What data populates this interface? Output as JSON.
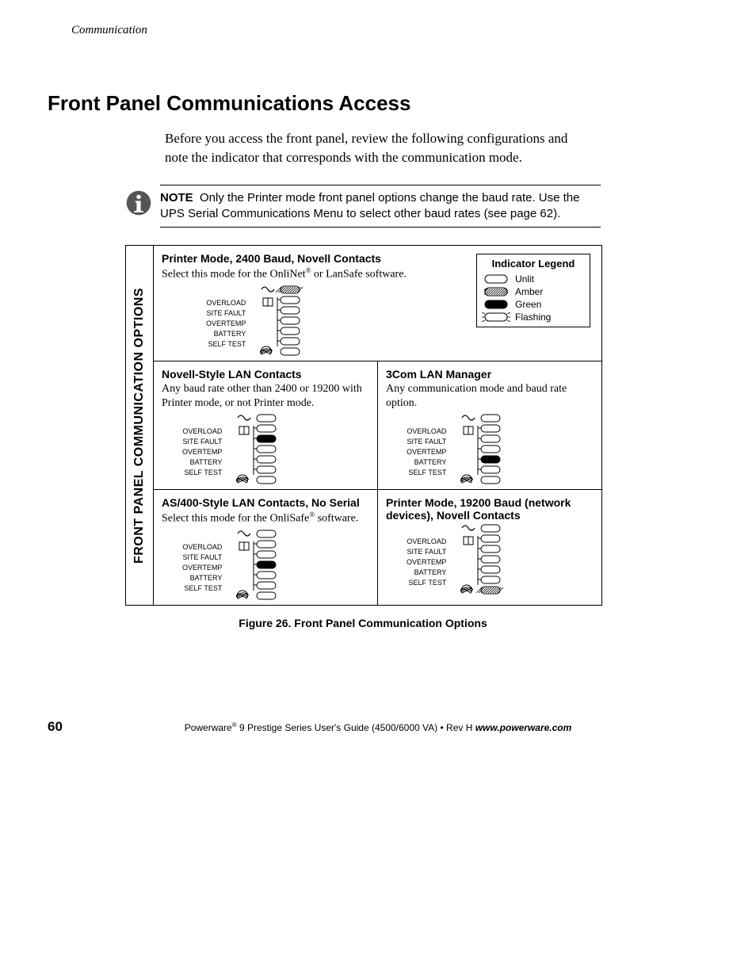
{
  "running_head": "Communication",
  "section_title": "Front Panel Communications Access",
  "intro": "Before you access the front panel, review the following configurations and note the indicator that corresponds with the communication mode.",
  "note_label": "NOTE",
  "note_body": "Only the Printer mode front panel options change the baud rate. Use the UPS Serial Communications Menu to select other baud rates (see page 62).",
  "sidebar_label": "FRONT PANEL COMMUNICATION OPTIONS",
  "panel_labels": [
    "OVERLOAD",
    "SITE FAULT",
    "OVERTEMP",
    "BATTERY",
    "SELF TEST"
  ],
  "cells": {
    "a": {
      "title": "Printer Mode, 2400 Baud, Novell Contacts",
      "desc_html": "Select this mode for the OnliNet<sup>®</sup> or LanSafe software."
    },
    "legend": {
      "title": "Indicator Legend",
      "items": [
        {
          "name": "Unlit",
          "kind": "unlit"
        },
        {
          "name": "Amber",
          "kind": "amber"
        },
        {
          "name": "Green",
          "kind": "green"
        },
        {
          "name": "Flashing",
          "kind": "flash"
        }
      ]
    },
    "b": {
      "title": "Novell-Style LAN Contacts",
      "desc": "Any baud rate other than 2400 or 19200 with Printer mode, or not Printer mode."
    },
    "c": {
      "title": "3Com LAN Manager",
      "desc": "Any communication mode and baud rate option."
    },
    "d": {
      "title": "AS/400-Style LAN Contacts, No Serial",
      "desc_html": "Select this mode for the OnliSafe<sup>®</sup> software."
    },
    "e": {
      "title": "Printer Mode, 19200 Baud (network devices), Novell Contacts",
      "desc": ""
    }
  },
  "figure_caption": "Figure 26. Front Panel Communication Options",
  "page_number": "60",
  "pub_prefix": "Powerware",
  "pub_reg": "®",
  "pub_mid": " 9 Prestige Series User's Guide (4500/6000 VA)  •  Rev H ",
  "pub_url": "www.powerware.com"
}
